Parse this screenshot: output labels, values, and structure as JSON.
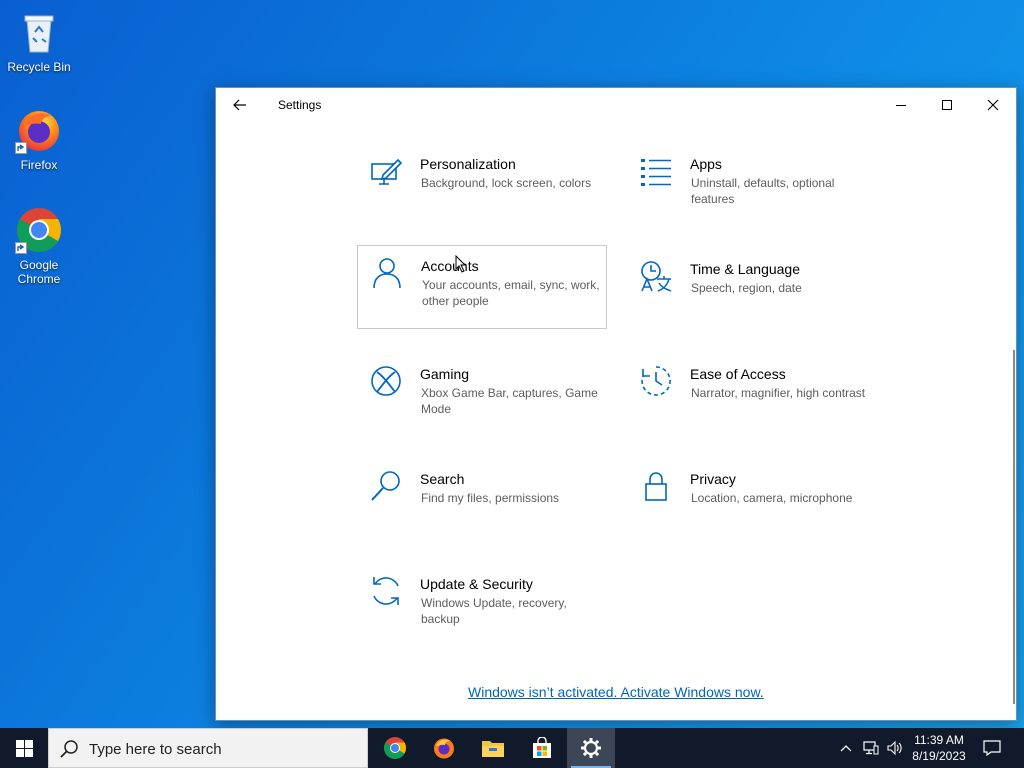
{
  "desktop": {
    "icons": [
      {
        "label": "Recycle Bin",
        "icon": "recycle-bin-icon"
      },
      {
        "label": "Firefox",
        "icon": "firefox-icon"
      },
      {
        "label": "Google Chrome",
        "icon": "chrome-icon"
      }
    ]
  },
  "window": {
    "title": "Settings",
    "back_icon": "back-arrow-icon",
    "controls": [
      "minimize-icon",
      "maximize-icon",
      "close-icon"
    ],
    "tiles": [
      {
        "name": "Personalization",
        "desc": "Background, lock screen, colors",
        "icon": "personalization-icon"
      },
      {
        "name": "Apps",
        "desc": "Uninstall, defaults, optional features",
        "icon": "apps-icon"
      },
      {
        "name": "Accounts",
        "desc": "Your accounts, email, sync, work, other people",
        "icon": "accounts-icon"
      },
      {
        "name": "Time & Language",
        "desc": "Speech, region, date",
        "icon": "time-language-icon"
      },
      {
        "name": "Gaming",
        "desc": "Xbox Game Bar, captures, Game Mode",
        "icon": "xbox-icon"
      },
      {
        "name": "Ease of Access",
        "desc": "Narrator, magnifier, high contrast",
        "icon": "ease-of-access-icon"
      },
      {
        "name": "Search",
        "desc": "Find my files, permissions",
        "icon": "search-icon"
      },
      {
        "name": "Privacy",
        "desc": "Location, camera, microphone",
        "icon": "lock-icon"
      },
      {
        "name": "Update & Security",
        "desc": "Windows Update, recovery, backup",
        "icon": "update-icon"
      }
    ],
    "activation_link": "Windows isn’t activated. Activate Windows now."
  },
  "taskbar": {
    "search_placeholder": "Type here to search",
    "apps": [
      "chrome-icon",
      "firefox-icon",
      "file-explorer-icon",
      "store-icon",
      "settings-gear-icon"
    ],
    "active_app": "settings-gear-icon",
    "time": "11:39 AM",
    "date": "8/19/2023"
  },
  "colors": {
    "accent": "#0067c0",
    "link": "#0066b4",
    "taskbar": "#101a2a"
  }
}
